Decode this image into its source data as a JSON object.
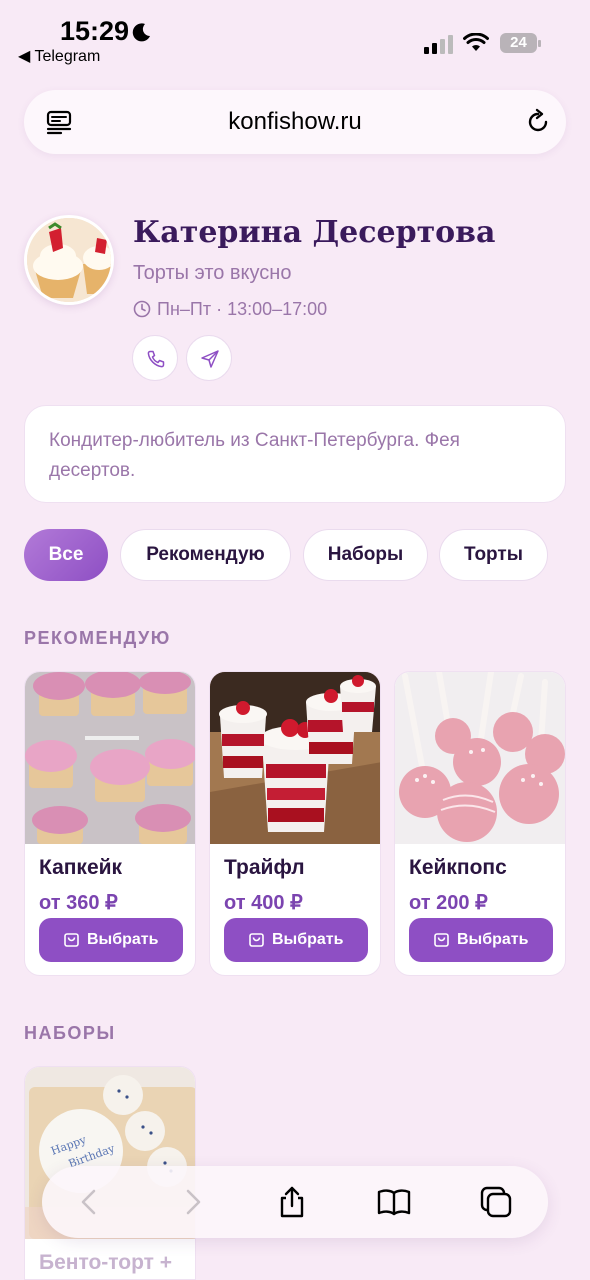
{
  "status_bar": {
    "time": "15:29",
    "back_app": "◀ Telegram",
    "battery": "24"
  },
  "browser": {
    "url": "konfishow.ru"
  },
  "profile": {
    "name": "Катерина Десертова",
    "tagline": "Торты это вкусно",
    "hours": "Пн–Пт · 13:00–17:00"
  },
  "bio": "Кондитер-любитель из Санкт-Петербурга. Фея десертов.",
  "filters": [
    {
      "label": "Все",
      "active": true
    },
    {
      "label": "Рекомендую",
      "active": false
    },
    {
      "label": "Наборы",
      "active": false
    },
    {
      "label": "Торты",
      "active": false
    }
  ],
  "sections": {
    "recommended": "РЕКОМЕНДУЮ",
    "sets": "НАБОРЫ"
  },
  "products": [
    {
      "name": "Капкейк",
      "price": "от 360 ₽",
      "button": "Выбрать"
    },
    {
      "name": "Трайфл",
      "price": "от 400 ₽",
      "button": "Выбрать"
    },
    {
      "name": "Кейкпопс",
      "price": "от 200 ₽",
      "button": "Выбрать"
    }
  ],
  "sets_items": [
    {
      "name": "Бенто-торт +"
    }
  ],
  "colors": {
    "background": "#f8eaf6",
    "accent": "#8e4fc4",
    "muted_text": "#9a76a9",
    "title": "#3a1a5c"
  }
}
